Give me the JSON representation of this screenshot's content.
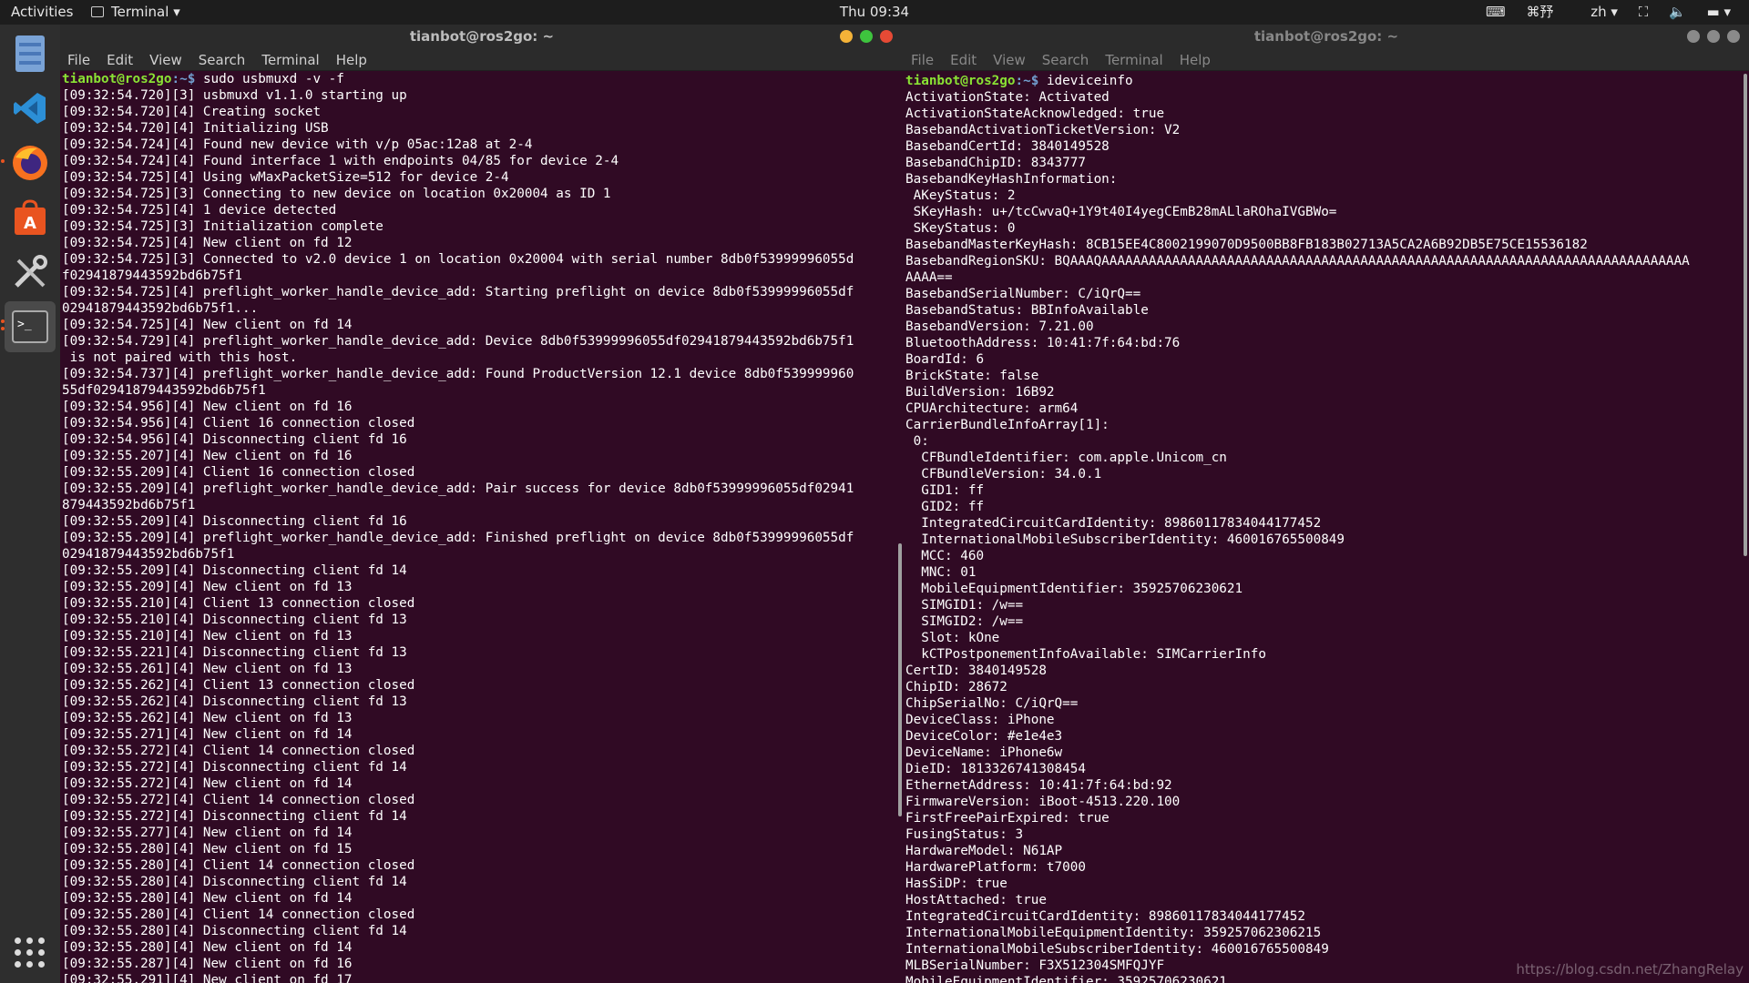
{
  "topbar": {
    "activities": "Activities",
    "app_name": "Terminal",
    "clock": "Thu 09:34",
    "keyboard_label": "⌘㐨",
    "lang": "zh"
  },
  "dock": {
    "items": [
      "files-icon",
      "vscode-icon",
      "firefox-icon",
      "software-center-icon",
      "tools-icon",
      "terminal-icon"
    ]
  },
  "left_window": {
    "title": "tianbot@ros2go: ~",
    "menu": [
      "File",
      "Edit",
      "View",
      "Search",
      "Terminal",
      "Help"
    ],
    "prompt_user": "tianbot@ros2go",
    "prompt_path": ":~$",
    "command": " sudo usbmuxd -v -f",
    "lines": [
      "[09:32:54.720][3] usbmuxd v1.1.0 starting up",
      "[09:32:54.720][4] Creating socket",
      "[09:32:54.720][4] Initializing USB",
      "[09:32:54.724][4] Found new device with v/p 05ac:12a8 at 2-4",
      "[09:32:54.724][4] Found interface 1 with endpoints 04/85 for device 2-4",
      "[09:32:54.725][4] Using wMaxPacketSize=512 for device 2-4",
      "[09:32:54.725][3] Connecting to new device on location 0x20004 as ID 1",
      "[09:32:54.725][4] 1 device detected",
      "[09:32:54.725][3] Initialization complete",
      "[09:32:54.725][4] New client on fd 12",
      "[09:32:54.725][3] Connected to v2.0 device 1 on location 0x20004 with serial number 8db0f53999996055d",
      "f02941879443592bd6b75f1",
      "[09:32:54.725][4] preflight_worker_handle_device_add: Starting preflight on device 8db0f53999996055df",
      "02941879443592bd6b75f1...",
      "[09:32:54.725][4] New client on fd 14",
      "[09:32:54.729][4] preflight_worker_handle_device_add: Device 8db0f53999996055df02941879443592bd6b75f1",
      " is not paired with this host.",
      "[09:32:54.737][4] preflight_worker_handle_device_add: Found ProductVersion 12.1 device 8db0f539999960",
      "55df02941879443592bd6b75f1",
      "[09:32:54.956][4] New client on fd 16",
      "[09:32:54.956][4] Client 16 connection closed",
      "[09:32:54.956][4] Disconnecting client fd 16",
      "[09:32:55.207][4] New client on fd 16",
      "[09:32:55.209][4] Client 16 connection closed",
      "[09:32:55.209][4] preflight_worker_handle_device_add: Pair success for device 8db0f53999996055df02941",
      "879443592bd6b75f1",
      "[09:32:55.209][4] Disconnecting client fd 16",
      "[09:32:55.209][4] preflight_worker_handle_device_add: Finished preflight on device 8db0f53999996055df",
      "02941879443592bd6b75f1",
      "[09:32:55.209][4] Disconnecting client fd 14",
      "[09:32:55.209][4] New client on fd 13",
      "[09:32:55.210][4] Client 13 connection closed",
      "[09:32:55.210][4] Disconnecting client fd 13",
      "[09:32:55.210][4] New client on fd 13",
      "[09:32:55.221][4] Disconnecting client fd 13",
      "[09:32:55.261][4] New client on fd 13",
      "[09:32:55.262][4] Client 13 connection closed",
      "[09:32:55.262][4] Disconnecting client fd 13",
      "[09:32:55.262][4] New client on fd 13",
      "[09:32:55.271][4] New client on fd 14",
      "[09:32:55.272][4] Client 14 connection closed",
      "[09:32:55.272][4] Disconnecting client fd 14",
      "[09:32:55.272][4] New client on fd 14",
      "[09:32:55.272][4] Client 14 connection closed",
      "[09:32:55.272][4] Disconnecting client fd 14",
      "[09:32:55.277][4] New client on fd 14",
      "[09:32:55.280][4] New client on fd 15",
      "[09:32:55.280][4] Client 14 connection closed",
      "[09:32:55.280][4] Disconnecting client fd 14",
      "[09:32:55.280][4] New client on fd 14",
      "[09:32:55.280][4] Client 14 connection closed",
      "[09:32:55.280][4] Disconnecting client fd 14",
      "[09:32:55.280][4] New client on fd 14",
      "[09:32:55.287][4] New client on fd 16",
      "[09:32:55.291][4] New client on fd 17"
    ]
  },
  "right_window": {
    "title": "tianbot@ros2go: ~",
    "menu": [
      "File",
      "Edit",
      "View",
      "Search",
      "Terminal",
      "Help"
    ],
    "prompt_user": "tianbot@ros2go",
    "prompt_path": ":~$",
    "command": " ideviceinfo",
    "lines": [
      "ActivationState: Activated",
      "ActivationStateAcknowledged: true",
      "BasebandActivationTicketVersion: V2",
      "BasebandCertId: 3840149528",
      "BasebandChipID: 8343777",
      "BasebandKeyHashInformation:",
      " AKeyStatus: 2",
      " SKeyHash: u+/tcCwvaQ+1Y9t40I4yegCEmB28mALlaROhaIVGBWo=",
      " SKeyStatus: 0",
      "BasebandMasterKeyHash: 8CB15EE4C8002199070D9500BB8FB183B02713A5CA2A6B92DB5E75CE15536182",
      "BasebandRegionSKU: BQAAAQAAAAAAAAAAAAAAAAAAAAAAAAAAAAAAAAAAAAAAAAAAAAAAAAAAAAAAAAAAAAAAAAAAAAAAAAAAA",
      "AAAA==",
      "BasebandSerialNumber: C/iQrQ==",
      "BasebandStatus: BBInfoAvailable",
      "BasebandVersion: 7.21.00",
      "BluetoothAddress: 10:41:7f:64:bd:76",
      "BoardId: 6",
      "BrickState: false",
      "BuildVersion: 16B92",
      "CPUArchitecture: arm64",
      "CarrierBundleInfoArray[1]:",
      " 0:",
      "  CFBundleIdentifier: com.apple.Unicom_cn",
      "  CFBundleVersion: 34.0.1",
      "  GID1: ff",
      "  GID2: ff",
      "  IntegratedCircuitCardIdentity: 89860117834044177452",
      "  InternationalMobileSubscriberIdentity: 460016765500849",
      "  MCC: 460",
      "  MNC: 01",
      "  MobileEquipmentIdentifier: 35925706230621",
      "  SIMGID1: /w==",
      "  SIMGID2: /w==",
      "  Slot: kOne",
      "  kCTPostponementInfoAvailable: SIMCarrierInfo",
      "CertID: 3840149528",
      "ChipID: 28672",
      "ChipSerialNo: C/iQrQ==",
      "DeviceClass: iPhone",
      "DeviceColor: #e1e4e3",
      "DeviceName: iPhone6w",
      "DieID: 1813326741308454",
      "EthernetAddress: 10:41:7f:64:bd:92",
      "FirmwareVersion: iBoot-4513.220.100",
      "FirstFreePairExpired: true",
      "FusingStatus: 3",
      "HardwareModel: N61AP",
      "HardwarePlatform: t7000",
      "HasSiDP: true",
      "HostAttached: true",
      "IntegratedCircuitCardIdentity: 89860117834044177452",
      "InternationalMobileEquipmentIdentity: 359257062306215",
      "InternationalMobileSubscriberIdentity: 460016765500849",
      "MLBSerialNumber: F3X512304SMFQJYF",
      "MobileEquipmentIdentifier: 35925706230621"
    ]
  },
  "watermark": "https://blog.csdn.net/ZhangRelay"
}
